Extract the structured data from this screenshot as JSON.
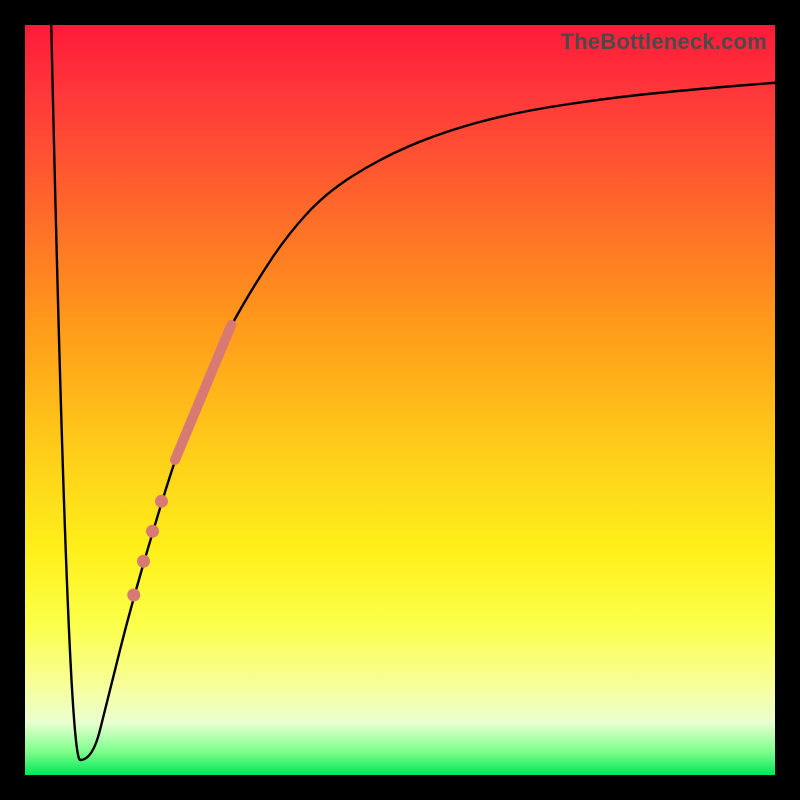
{
  "watermark": "TheBottleneck.com",
  "chart_data": {
    "type": "line",
    "title": "",
    "xlabel": "",
    "ylabel": "",
    "xlim": [
      0,
      100
    ],
    "ylim": [
      0,
      100
    ],
    "grid": false,
    "legend": false,
    "background_gradient_stops": [
      {
        "pct": 0,
        "color": "#ff1a3a"
      },
      {
        "pct": 10,
        "color": "#ff3a3a"
      },
      {
        "pct": 25,
        "color": "#ff6a2a"
      },
      {
        "pct": 40,
        "color": "#ff9a1a"
      },
      {
        "pct": 55,
        "color": "#ffc81a"
      },
      {
        "pct": 70,
        "color": "#fff01a"
      },
      {
        "pct": 80,
        "color": "#fbff4a"
      },
      {
        "pct": 88,
        "color": "#f7ff9a"
      },
      {
        "pct": 93,
        "color": "#eaffd0"
      },
      {
        "pct": 97,
        "color": "#7aff8a"
      },
      {
        "pct": 100,
        "color": "#00e65a"
      }
    ],
    "series": [
      {
        "name": "bottleneck-curve",
        "color": "#000000",
        "stroke_width": 2.4,
        "x": [
          3.5,
          5.7,
          9.0,
          11.0,
          14.0,
          17.5,
          20.0,
          22.5,
          25.0,
          27.5,
          31.0,
          35.0,
          40.0,
          47.0,
          55.0,
          65.0,
          78.0,
          90.0,
          100.0
        ],
        "y": [
          100.0,
          2.0,
          2.0,
          10.0,
          22.0,
          34.0,
          42.0,
          49.0,
          55.0,
          60.0,
          66.0,
          72.0,
          77.5,
          82.0,
          85.5,
          88.3,
          90.3,
          91.5,
          92.3
        ]
      }
    ],
    "highlight_band": {
      "name": "highlight-band",
      "color": "#d87a73",
      "stroke_width": 10,
      "x": [
        20.0,
        27.5
      ],
      "y": [
        42.0,
        60.0
      ]
    },
    "highlight_dots": {
      "name": "highlight-dots",
      "color": "#d87a73",
      "radius": 6.5,
      "points": [
        {
          "x": 18.2,
          "y": 36.5
        },
        {
          "x": 17.0,
          "y": 32.5
        },
        {
          "x": 15.8,
          "y": 28.5
        },
        {
          "x": 14.5,
          "y": 24.0
        }
      ]
    }
  }
}
